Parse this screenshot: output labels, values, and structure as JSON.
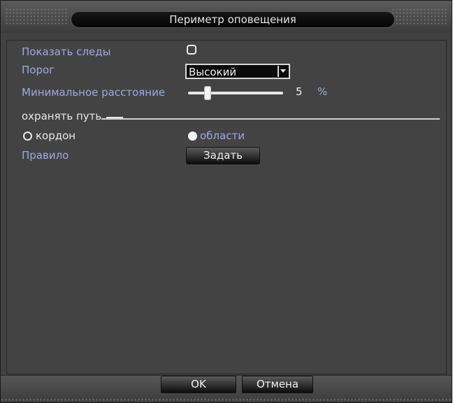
{
  "dialog": {
    "title": "Периметр оповещения"
  },
  "fields": {
    "show_traces": {
      "label": "Показать следы",
      "checked": false
    },
    "threshold": {
      "label": "Порог",
      "value": "Высокий"
    },
    "min_distance": {
      "label": "Минимальное расстояние",
      "value": "5",
      "unit": "%",
      "fraction": 0.18
    },
    "protect_path": {
      "label": "охранять путь"
    },
    "mode": {
      "options": [
        {
          "label": "кордон",
          "selected": false
        },
        {
          "label": "области",
          "selected": true
        }
      ]
    },
    "rule": {
      "label": "Правило",
      "button_label": "Задать"
    }
  },
  "footer": {
    "ok_label": "OK",
    "cancel_label": "Отмена"
  },
  "colors": {
    "label_blue": "#9fa8e6",
    "panel_bg": "#434343"
  }
}
